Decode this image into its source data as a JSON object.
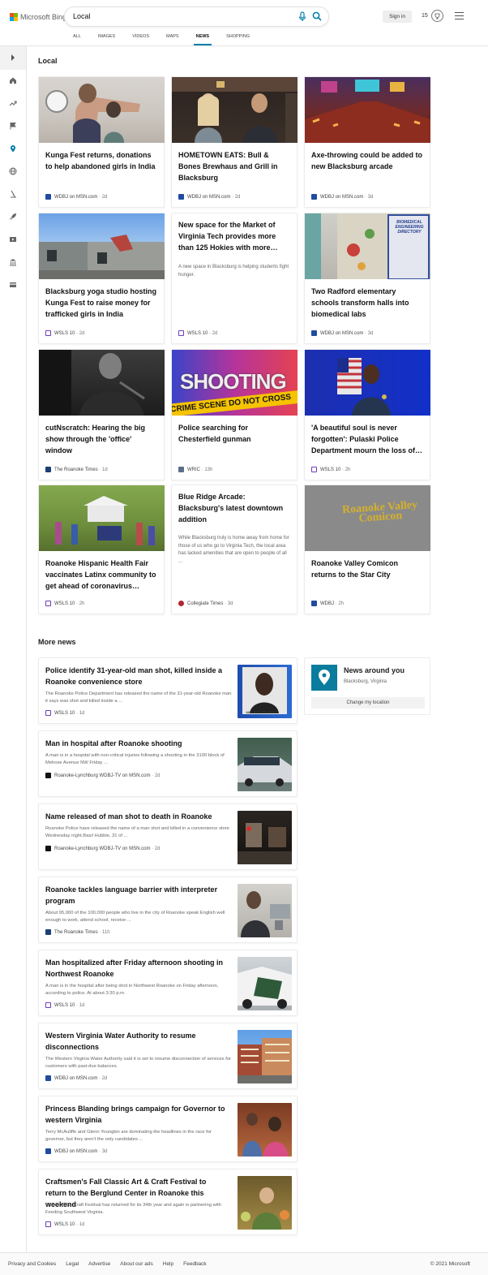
{
  "header": {
    "logo_text": "Microsoft Bing",
    "search_value": "Local",
    "signin_label": "Sign in",
    "rewards_count": "15",
    "tabs": [
      {
        "label": "ALL"
      },
      {
        "label": "IMAGES"
      },
      {
        "label": "VIDEOS"
      },
      {
        "label": "MAPS"
      },
      {
        "label": "NEWS"
      },
      {
        "label": "SHOPPING"
      }
    ]
  },
  "sidebar": {
    "items": [
      "chevron-right-icon",
      "home-icon",
      "trending-icon",
      "flag-icon",
      "location-icon",
      "globe-icon",
      "science-icon",
      "rocket-icon",
      "video-icon",
      "bank-icon",
      "card-icon"
    ]
  },
  "local": {
    "title": "Local",
    "cards": [
      {
        "title": "Kunga Fest returns, donations to help abandoned girls in India",
        "source": "WDBJ on MSN.com",
        "age": "2d",
        "desc": ""
      },
      {
        "title": "HOMETOWN EATS: Bull & Bones Brewhaus and Grill in Blacksburg",
        "source": "WDBJ on MSN.com",
        "age": "2d",
        "desc": ""
      },
      {
        "title": "Axe-throwing could be added to new Blacksburg arcade",
        "source": "WDBJ on MSN.com",
        "age": "3d",
        "desc": ""
      },
      {
        "title": "Blacksburg yoga studio hosting Kunga Fest to raise money for trafficked girls in India",
        "source": "WSLS 10",
        "age": "2d",
        "desc": ""
      },
      {
        "title": "New space for the Market of Virginia Tech provides more than 125 Hokies with more…",
        "source": "WSLS 10",
        "age": "2d",
        "desc": "A new space in Blacksburg is helping students fight hunger."
      },
      {
        "title": "Two Radford elementary schools transform halls into biomedical labs",
        "source": "WDBJ on MSN.com",
        "age": "3d",
        "desc": ""
      },
      {
        "title": "cutNscratch: Hearing the big show through the 'office' window",
        "source": "The Roanoke Times",
        "age": "1d",
        "desc": ""
      },
      {
        "title": "Police searching for Chesterfield gunman",
        "source": "WRIC",
        "age": "13h",
        "desc": ""
      },
      {
        "title": "'A beautiful soul is never forgotten': Pulaski Police Department mourn the loss of…",
        "source": "WSLS 10",
        "age": "2h",
        "desc": ""
      },
      {
        "title": "Roanoke Hispanic Health Fair vaccinates Latinx community to get ahead of coronavirus…",
        "source": "WSLS 10",
        "age": "2h",
        "desc": ""
      },
      {
        "title": "Blue Ridge Arcade: Blacksburg's latest downtown addition",
        "source": "Collegiate Times",
        "age": "3d",
        "desc": "While Blacksburg truly is home away from home for those of us who go to Virginia Tech, the local area has lacked amenities that are open to people of all ..."
      },
      {
        "title": "Roanoke Valley Comicon returns to the Star City",
        "source": "WDBJ",
        "age": "2h",
        "desc": ""
      }
    ],
    "image_text": {
      "shooting": "SHOOTING",
      "tape": "CRIME SCENE DO NOT CROSS",
      "directory": "BIOMEDICAL ENGINEERING DIRECTORY",
      "comicon": "Roanoke Valley Comicon"
    }
  },
  "more": {
    "title": "More news",
    "items": [
      {
        "title": "Police identify 31-year-old man shot, killed inside a Roanoke convenience store",
        "desc": "The Roanoke Police Department has released the name of the 31-year-old Roanoke man it says was shot and killed inside a ...",
        "source": "WSLS 10",
        "age": "1d",
        "caption": "JAMERIUS CROMWELL"
      },
      {
        "title": "Man in hospital after Roanoke shooting",
        "desc": "A man is in a hospital with non-critical injuries following a shooting in the 3100 block of Melrose Avenue NW Friday ...",
        "source": "Roanoke-Lynchburg WDBJ-TV on MSN.com",
        "age": "2d",
        "caption": ""
      },
      {
        "title": "Name released of man shot to death in Roanoke",
        "desc": "Roanoke Police have released the name of a man shot and killed in a convenience store Wednesday night.Basil Hubble, 31 of ...",
        "source": "Roanoke-Lynchburg WDBJ-TV on MSN.com",
        "age": "2d",
        "caption": ""
      },
      {
        "title": "Roanoke tackles language barrier with interpreter program",
        "desc": "About 95,000 of the 100,000 people who live in the city of Roanoke speak English well enough to work, attend school, receive ...",
        "source": "The Roanoke Times",
        "age": "11h",
        "caption": ""
      },
      {
        "title": "Man hospitalized after Friday afternoon shooting in Northwest Roanoke",
        "desc": "A man is in the hospital after being shot in Northwest Roanoke on Friday afternoon, according to police. At about 3:30 p.m.",
        "source": "WSLS 10",
        "age": "1d",
        "caption": ""
      },
      {
        "title": "Western Virginia Water Authority to resume disconnections",
        "desc": "The Western Virginia Water Authority said it is set to resume disconnection of services for customers with past-due balances.",
        "source": "WDBJ on MSN.com",
        "age": "2d",
        "caption": ""
      },
      {
        "title": "Princess Blanding brings campaign for Governor to western Virginia",
        "desc": "Terry McAuliffe and Glenn Youngkin are dominating the headlines in the race for governor, but they aren't the only candidates ...",
        "source": "WDBJ on MSN.com",
        "age": "3d",
        "caption": ""
      },
      {
        "title": "Craftsmen's Fall Classic Art & Craft Festival to return to the Berglund Center in Roanoke this weekend",
        "desc": "Classic Art & Craft Festival has returned for its 34th year and again is partnering with Feeding Southwest Virginia.",
        "source": "WSLS 10",
        "age": "1d",
        "caption": ""
      }
    ]
  },
  "around": {
    "title": "News around you",
    "location": "Blacksburg, Virginia",
    "button": "Change my location"
  },
  "footer": {
    "links": [
      "Privacy and Cookies",
      "Legal",
      "Advertise",
      "About our ads",
      "Help",
      "Feedback"
    ],
    "copyright": "© 2021 Microsoft"
  },
  "colors": {
    "accent": "#007daa",
    "ms_red": "#f25022",
    "ms_green": "#7fba00",
    "ms_blue": "#00a4ef",
    "ms_yellow": "#ffb900"
  }
}
